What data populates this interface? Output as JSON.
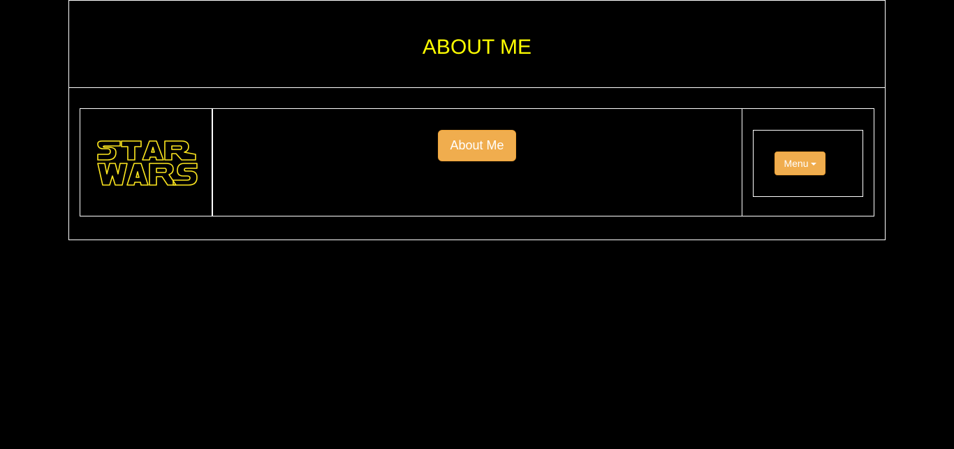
{
  "header": {
    "title": "ABOUT ME",
    "title_color": "#ffff00"
  },
  "logo": {
    "text_line1": "STAR",
    "text_line2": "WARS",
    "color": "#ffe81f"
  },
  "main": {
    "about_button_label": "About Me"
  },
  "menu": {
    "button_label": "Menu",
    "icon": "caret-down-icon"
  },
  "colors": {
    "background": "#000000",
    "border": "#ffffff",
    "button_bg": "#f0ad4e"
  }
}
